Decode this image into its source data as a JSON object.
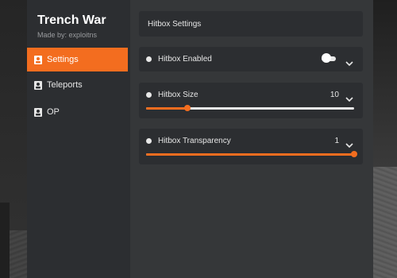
{
  "app": {
    "title": "Trench War",
    "subtitle": "Made by: exploitns"
  },
  "sidebar": {
    "items": [
      {
        "label": "Settings",
        "active": true,
        "icon": "user-badge-icon"
      },
      {
        "label": "Teleports",
        "active": false,
        "icon": "user-badge-icon"
      },
      {
        "label": "OP",
        "active": false,
        "icon": "user-badge-icon"
      }
    ]
  },
  "main": {
    "header": "Hitbox Settings",
    "hitbox_enabled": {
      "label": "Hitbox Enabled",
      "on": true
    },
    "hitbox_size": {
      "label": "Hitbox Size",
      "value": "10",
      "fraction": 0.2
    },
    "hitbox_transparency": {
      "label": "Hitbox Transparency",
      "value": "1",
      "fraction": 1.0
    }
  },
  "colors": {
    "accent": "#f36d1f",
    "panel": "#2c2e31",
    "main_bg": "#353739"
  }
}
